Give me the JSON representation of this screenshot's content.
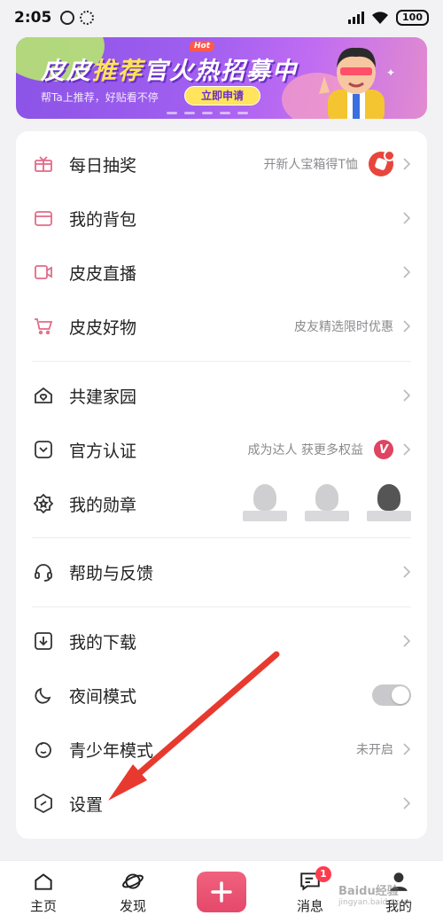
{
  "status_bar": {
    "time": "2:05",
    "battery": "100"
  },
  "banner": {
    "title_part1": "皮皮",
    "title_highlight": "推荐",
    "title_part2": "官火热招募中",
    "hot_tag": "Hot",
    "subtitle": "帮Ta上推荐，好贴看不停",
    "apply_label": "立即申请"
  },
  "menu": {
    "items": [
      {
        "label": "每日抽奖",
        "hint": "开新人宝箱得T恤",
        "icon": "gift-icon"
      },
      {
        "label": "我的背包",
        "hint": "",
        "icon": "bag-icon"
      },
      {
        "label": "皮皮直播",
        "hint": "",
        "icon": "live-icon"
      },
      {
        "label": "皮皮好物",
        "hint": "皮友精选限时优惠",
        "icon": "cart-icon"
      },
      {
        "label": "共建家园",
        "hint": "",
        "icon": "home-heart-icon"
      },
      {
        "label": "官方认证",
        "hint": "成为达人 获更多权益",
        "icon": "verify-icon",
        "badge": "V"
      },
      {
        "label": "我的勋章",
        "hint": "",
        "icon": "medal-icon"
      },
      {
        "label": "帮助与反馈",
        "hint": "",
        "icon": "headset-icon"
      },
      {
        "label": "我的下载",
        "hint": "",
        "icon": "download-icon"
      },
      {
        "label": "夜间模式",
        "hint": "",
        "icon": "moon-icon",
        "toggle": "off"
      },
      {
        "label": "青少年模式",
        "hint": "未开启",
        "icon": "child-icon"
      },
      {
        "label": "设置",
        "hint": "",
        "icon": "settings-icon"
      }
    ]
  },
  "bottom_nav": {
    "home": "主页",
    "discover": "发现",
    "messages": "消息",
    "messages_badge": "1",
    "mine": "我的"
  },
  "watermark": {
    "line1": "Baidu经验",
    "line2": "jingyan.baidu.com"
  },
  "colors": {
    "accent": "#e5486a",
    "icon_pink": "#e36a86",
    "arrow_red": "#e8392f"
  }
}
